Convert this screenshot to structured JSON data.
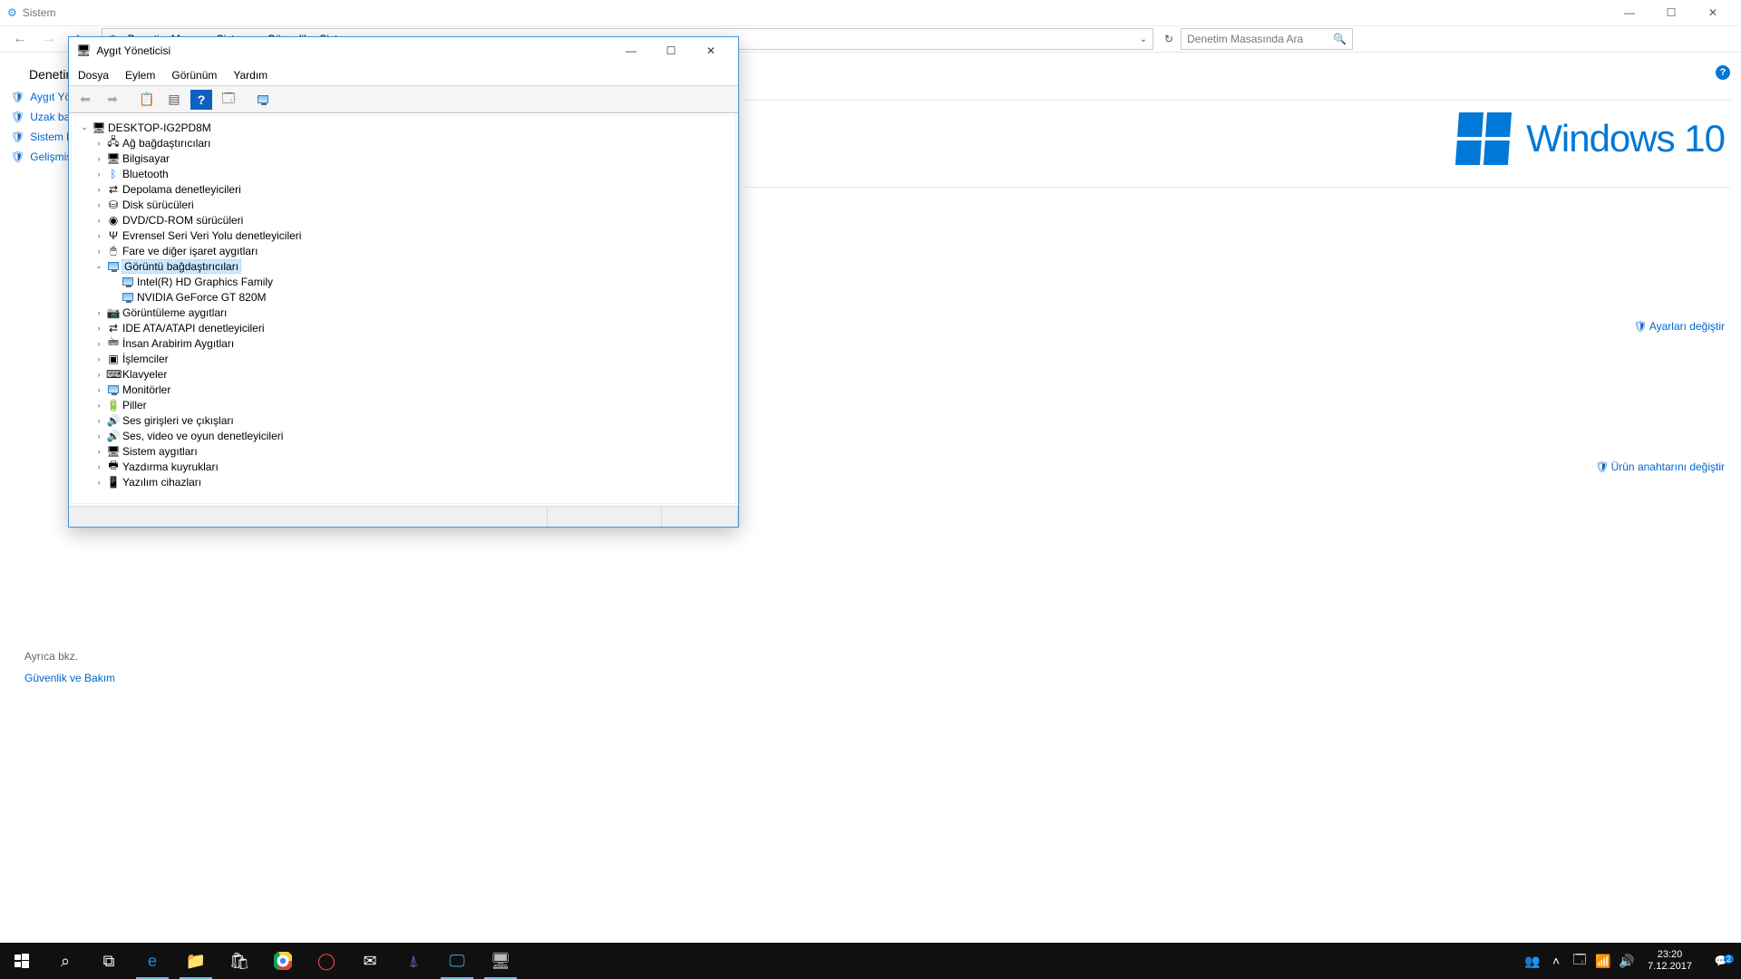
{
  "outer": {
    "title": "Sistem",
    "breadcrumb": [
      "Denetim Masası",
      "Sistem ve Güvenlik",
      "Sistem"
    ],
    "search_placeholder": "Denetim Masasında Ara",
    "sidebar_title": "Denetim",
    "sidebar_items": [
      "Aygıt Yön",
      "Uzak bağ",
      "Sistem ko",
      "Gelişmiş s"
    ],
    "logo_text": "Windows 10",
    "change_settings": "Ayarları değiştir",
    "change_product_key": "Ürün anahtarını değiştir",
    "also_see_header": "Ayrıca bkz.",
    "also_see_link": "Güvenlik ve Bakım"
  },
  "devmgr": {
    "title": "Aygıt Yöneticisi",
    "menus": [
      "Dosya",
      "Eylem",
      "Görünüm",
      "Yardım"
    ],
    "root": "DESKTOP-IG2PD8M",
    "categories": [
      {
        "label": "Ağ bağdaştırıcıları",
        "icon": "🖧"
      },
      {
        "label": "Bilgisayar",
        "icon": "🖥"
      },
      {
        "label": "Bluetooth",
        "icon": "ᛒ",
        "iconColor": "#0a6ed1"
      },
      {
        "label": "Depolama denetleyicileri",
        "icon": "⇄"
      },
      {
        "label": "Disk sürücüleri",
        "icon": "⛁"
      },
      {
        "label": "DVD/CD-ROM sürücüleri",
        "icon": "◉"
      },
      {
        "label": "Evrensel Seri Veri Yolu denetleyicileri",
        "icon": "Ψ"
      },
      {
        "label": "Fare ve diğer işaret aygıtları",
        "icon": "🖱"
      },
      {
        "label": "Görüntü bağdaştırıcıları",
        "icon": "mon",
        "expanded": true,
        "selected": true,
        "children": [
          "Intel(R) HD Graphics Family",
          "NVIDIA GeForce GT 820M"
        ]
      },
      {
        "label": "Görüntüleme aygıtları",
        "icon": "📷"
      },
      {
        "label": "IDE ATA/ATAPI denetleyicileri",
        "icon": "⇄"
      },
      {
        "label": "İnsan Arabirim Aygıtları",
        "icon": "🖮"
      },
      {
        "label": "İşlemciler",
        "icon": "▣"
      },
      {
        "label": "Klavyeler",
        "icon": "⌨"
      },
      {
        "label": "Monitörler",
        "icon": "mon"
      },
      {
        "label": "Piller",
        "icon": "🔋"
      },
      {
        "label": "Ses girişleri ve çıkışları",
        "icon": "🔊"
      },
      {
        "label": "Ses, video ve oyun denetleyicileri",
        "icon": "🔊"
      },
      {
        "label": "Sistem aygıtları",
        "icon": "🖥"
      },
      {
        "label": "Yazdırma kuyrukları",
        "icon": "🖶"
      },
      {
        "label": "Yazılım cihazları",
        "icon": "📱"
      }
    ]
  },
  "taskbar": {
    "time": "23:20",
    "date": "7.12.2017",
    "notif_count": "2"
  }
}
